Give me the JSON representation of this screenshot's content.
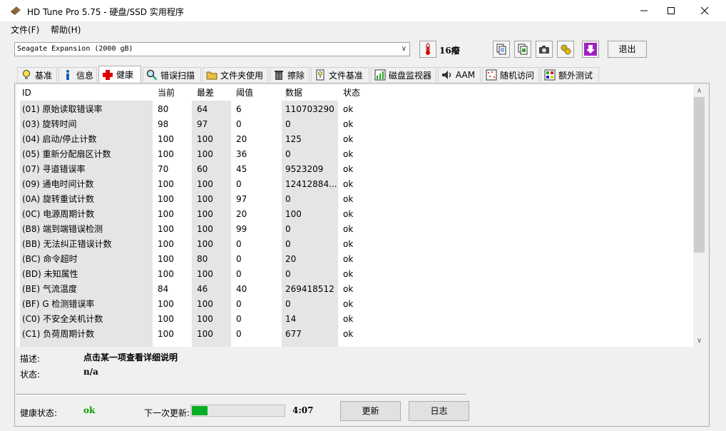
{
  "window": {
    "title": "HD Tune Pro 5.75 - 硬盘/SSD 实用程序"
  },
  "menu": {
    "file": "文件(F)",
    "help": "帮助(H)"
  },
  "toolbar": {
    "drive": "Seagate Expansion (2000 gB)",
    "temperature": "16癈",
    "exit_label": "退出"
  },
  "tabs": [
    {
      "label": "基准",
      "icon": "lightbulb-icon"
    },
    {
      "label": "信息",
      "icon": "info-icon"
    },
    {
      "label": "健康",
      "icon": "health-cross-icon"
    },
    {
      "label": "错误扫描",
      "icon": "magnifier-icon"
    },
    {
      "label": "文件夹使用",
      "icon": "folder-icon"
    },
    {
      "label": "擦除",
      "icon": "trash-icon"
    },
    {
      "label": "文件基准",
      "icon": "file-benchmark-icon"
    },
    {
      "label": "磁盘监视器",
      "icon": "monitor-chart-icon"
    },
    {
      "label": "AAM",
      "icon": "speaker-icon"
    },
    {
      "label": "随机访问",
      "icon": "random-access-icon"
    },
    {
      "label": "额外测试",
      "icon": "extra-tests-icon"
    }
  ],
  "table": {
    "headers": [
      "ID",
      "当前",
      "最差",
      "阈值",
      "数据",
      "状态"
    ],
    "rows": [
      [
        "(01) 原始读取错误率",
        "80",
        "64",
        "6",
        "110703290",
        "ok"
      ],
      [
        "(03) 旋转时间",
        "98",
        "97",
        "0",
        "0",
        "ok"
      ],
      [
        "(04) 启动/停止计数",
        "100",
        "100",
        "20",
        "125",
        "ok"
      ],
      [
        "(05) 重新分配扇区计数",
        "100",
        "100",
        "36",
        "0",
        "ok"
      ],
      [
        "(07) 寻道错误率",
        "70",
        "60",
        "45",
        "9523209",
        "ok"
      ],
      [
        "(09) 通电时间计数",
        "100",
        "100",
        "0",
        "12412884...",
        "ok"
      ],
      [
        "(0A) 旋转重试计数",
        "100",
        "100",
        "97",
        "0",
        "ok"
      ],
      [
        "(0C) 电源周期计数",
        "100",
        "100",
        "20",
        "100",
        "ok"
      ],
      [
        "(B8) 端到端错误检测",
        "100",
        "100",
        "99",
        "0",
        "ok"
      ],
      [
        "(BB) 无法纠正错误计数",
        "100",
        "100",
        "0",
        "0",
        "ok"
      ],
      [
        "(BC) 命令超时",
        "100",
        "80",
        "0",
        "20",
        "ok"
      ],
      [
        "(BD) 未知属性",
        "100",
        "100",
        "0",
        "0",
        "ok"
      ],
      [
        "(BE) 气流温度",
        "84",
        "46",
        "40",
        "269418512",
        "ok"
      ],
      [
        "(BF) G 检测错误率",
        "100",
        "100",
        "0",
        "0",
        "ok"
      ],
      [
        "(C0) 不安全关机计数",
        "100",
        "100",
        "0",
        "14",
        "ok"
      ],
      [
        "(C1) 负荷周期计数",
        "100",
        "100",
        "0",
        "677",
        "ok"
      ]
    ]
  },
  "details": {
    "desc_label": "描述:",
    "desc_value": "点击某一项查看详细说明",
    "status_label": "状态:",
    "status_value": "n/a"
  },
  "footer": {
    "health_label": "健康状态:",
    "health_value": "ok",
    "next_update_label": "下一次更新:",
    "next_update_progress": 0.17,
    "countdown": "4:07",
    "refresh_label": "更新",
    "log_label": "日志"
  },
  "colors": {
    "health_ok": "#00a000",
    "progress_fill": "#06b025"
  }
}
